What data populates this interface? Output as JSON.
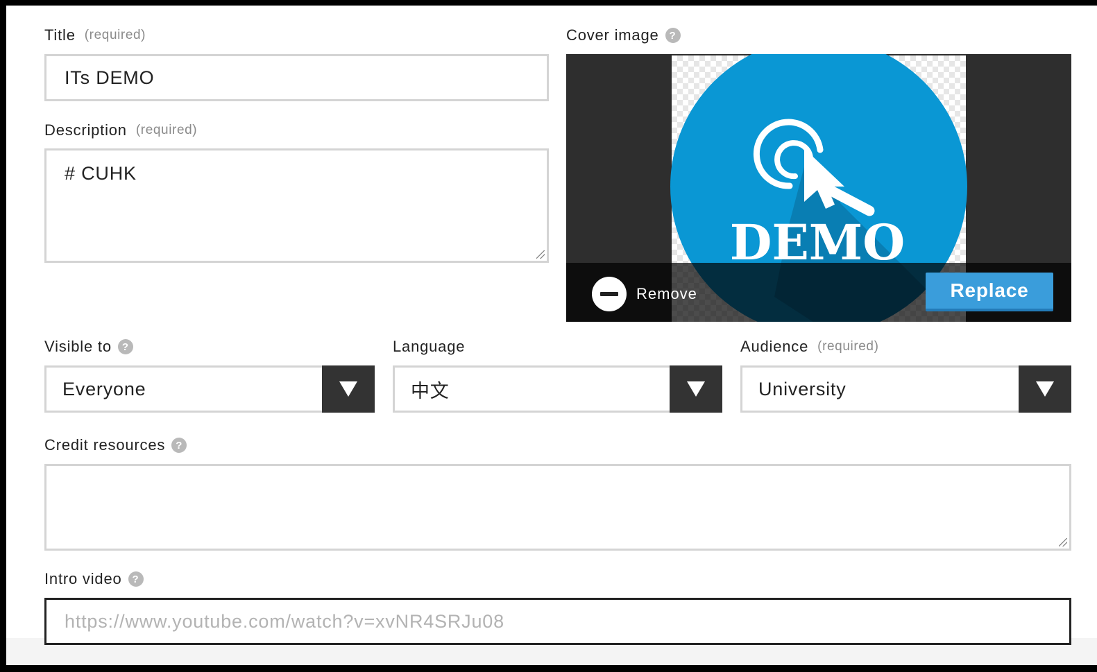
{
  "form": {
    "title": {
      "label": "Title",
      "required": "(required)",
      "value": "ITs DEMO"
    },
    "description": {
      "label": "Description",
      "required": "(required)",
      "value": "# CUHK"
    },
    "cover": {
      "label": "Cover image",
      "image_text": "DEMO",
      "remove_label": "Remove",
      "replace_label": "Replace"
    },
    "visible_to": {
      "label": "Visible to",
      "value": "Everyone"
    },
    "language": {
      "label": "Language",
      "value": "中文"
    },
    "audience": {
      "label": "Audience",
      "required": "(required)",
      "value": "University"
    },
    "credit": {
      "label": "Credit resources",
      "value": ""
    },
    "intro_video": {
      "label": "Intro video",
      "placeholder": "https://www.youtube.com/watch?v=xvNR4SRJu08"
    },
    "help_glyph": "?"
  },
  "colors": {
    "accent": "#3a9ddb",
    "cover_circle": "#0a97d4",
    "cover_shadow": "#0a6a97",
    "dark": "#333333"
  }
}
